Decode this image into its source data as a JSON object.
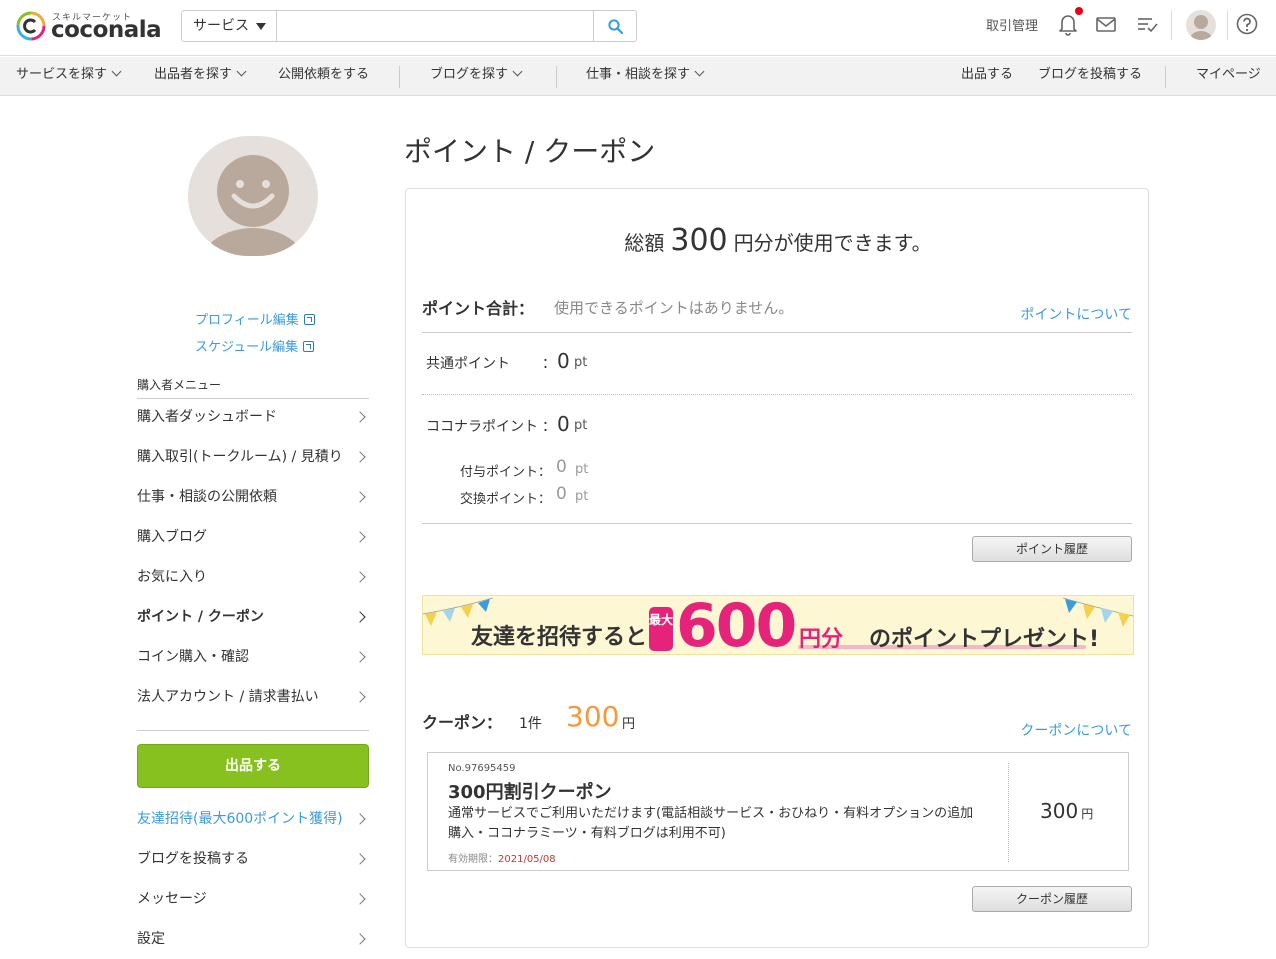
{
  "header": {
    "logo_small": "スキルマーケット",
    "logo_text": "coconala",
    "search_category": "サービス",
    "search_placeholder": "",
    "torihiki": "取引管理"
  },
  "nav": {
    "items": [
      "サービスを探す",
      "出品者を探す",
      "公開依頼をする",
      "ブログを探す",
      "仕事・相談を探す"
    ],
    "right": [
      "出品する",
      "ブログを投稿する",
      "マイページ"
    ]
  },
  "sidebar": {
    "profile_edit": "プロフィール編集",
    "schedule_edit": "スケジュール編集",
    "menu_heading": "購入者メニュー",
    "items": [
      "購入者ダッシュボード",
      "購入取引(トークルーム) / 見積り",
      "仕事・相談の公開依頼",
      "購入ブログ",
      "お気に入り",
      "ポイント / クーポン",
      "コイン購入・確認",
      "法人アカウント / 請求書払い"
    ],
    "sell_button": "出品する",
    "items2": [
      "友達招待(最大600ポイント獲得)",
      "ブログを投稿する",
      "メッセージ",
      "設定"
    ]
  },
  "main": {
    "title": "ポイント / クーポン",
    "total_prefix": "総額",
    "total_value": "300",
    "total_suffix": "円分が使用できます。",
    "points": {
      "label": "ポイント合計：",
      "none_text": "使用できるポイントはありません。",
      "about_link": "ポイントについて",
      "common_label": "共通ポイント",
      "common_value": "0",
      "coconala_label": "ココナラポイント",
      "coconala_value": "0",
      "granted_label": "付与ポイント：",
      "granted_value": "0",
      "exchange_label": "交換ポイント：",
      "exchange_value": "0",
      "unit": "pt",
      "colon": "：",
      "history_button": "ポイント履歴"
    },
    "banner": {
      "text_before": "友達を招待すると",
      "max_label": "最大",
      "amount": "600",
      "yen_label": "円分",
      "text_after": "のポイントプレゼント!"
    },
    "coupons": {
      "label": "クーポン：",
      "count": "1件",
      "amount": "300",
      "yen": "円",
      "about_link": "クーポンについて",
      "item": {
        "number": "No.97695459",
        "title": "300円割引クーポン",
        "description": "通常サービスでご利用いただけます(電話相談サービス・おひねり・有料オプションの追加 購入・ココナラミーツ・有料ブログは利用不可)",
        "expiry_label": "有効期限：",
        "expiry_date": "2021/05/08",
        "price": "300",
        "price_unit": "円"
      },
      "history_button": "クーポン履歴"
    }
  },
  "colors": {
    "accent_blue": "#3a9be0",
    "sell_green": "#86c11f",
    "coupon_orange": "#f29a3c",
    "banner_pink": "#e6237b"
  }
}
